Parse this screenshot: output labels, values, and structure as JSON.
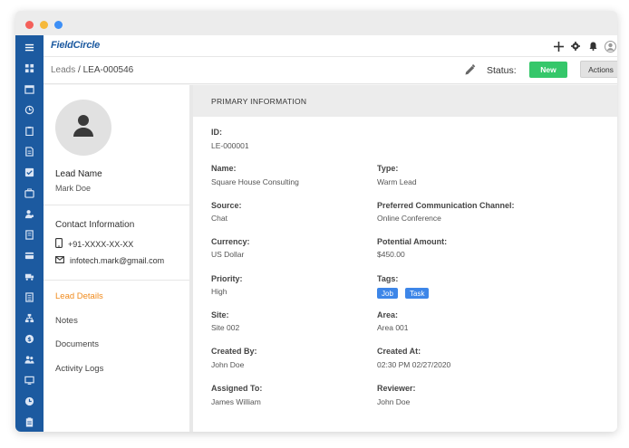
{
  "app": {
    "logo": "FieldCircle"
  },
  "breadcrumb": {
    "root": "Leads",
    "separator": " / ",
    "current": "LEA-000546"
  },
  "status": {
    "label": "Status:",
    "badge": "New",
    "badge_color": "#35c76a"
  },
  "actions": {
    "label": "Actions"
  },
  "lead": {
    "name_label": "Lead Name",
    "name": "Mark Doe"
  },
  "contact": {
    "title": "Contact Information",
    "phone": "+91-XXXX-XX-XX",
    "email": "infotech.mark@gmail.com"
  },
  "nav": [
    {
      "label": "Lead Details",
      "active": true
    },
    {
      "label": "Notes",
      "active": false
    },
    {
      "label": "Documents",
      "active": false
    },
    {
      "label": "Activity Logs",
      "active": false
    }
  ],
  "primary": {
    "title": "PRIMARY INFORMATION",
    "id": {
      "label": "ID:",
      "value": "LE-000001"
    },
    "name": {
      "label": "Name:",
      "value": "Square House Consulting"
    },
    "type": {
      "label": "Type:",
      "value": "Warm Lead"
    },
    "source": {
      "label": "Source:",
      "value": "Chat"
    },
    "channel": {
      "label": "Preferred Communication Channel:",
      "value": "Online Conference"
    },
    "currency": {
      "label": "Currency:",
      "value": "US Dollar"
    },
    "amount": {
      "label": "Potential Amount:",
      "value": "$450.00"
    },
    "priority": {
      "label": "Priority:",
      "value": "High"
    },
    "tags": {
      "label": "Tags:",
      "items": [
        "Job",
        "Task"
      ]
    },
    "site": {
      "label": "Site:",
      "value": "Site 002"
    },
    "area": {
      "label": "Area:",
      "value": "Area 001"
    },
    "created_by": {
      "label": "Created By:",
      "value": "John Doe"
    },
    "created_at": {
      "label": "Created At:",
      "value": "02:30 PM 02/27/2020"
    },
    "assigned_to": {
      "label": "Assigned To:",
      "value": "James William"
    },
    "reviewer": {
      "label": "Reviewer:",
      "value": "John Doe"
    }
  },
  "icons": {
    "sidebar": [
      "menu-icon",
      "dashboard-icon",
      "calendar-icon",
      "dispatch-icon",
      "clipboard-icon",
      "document-icon",
      "checklist-icon",
      "briefcase-icon",
      "user-icon",
      "invoice-icon",
      "card-icon",
      "truck-icon",
      "list-icon",
      "org-icon",
      "dollar-icon",
      "team-icon",
      "monitor-icon",
      "clock-icon",
      "report-icon"
    ],
    "top": [
      "plus-icon",
      "gear-icon",
      "bell-icon",
      "user-avatar-icon"
    ]
  },
  "colors": {
    "brand": "#1c5aa0",
    "accent": "#f08a1c",
    "tag": "#3d86e8"
  }
}
